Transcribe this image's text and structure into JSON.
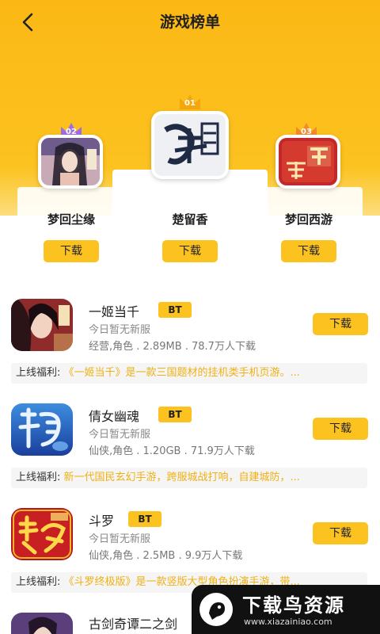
{
  "header": {
    "title": "游戏榜单"
  },
  "ranking": [
    {
      "rank": "02",
      "name": "梦回尘缘",
      "button": "下载"
    },
    {
      "rank": "01",
      "name": "楚留香",
      "button": "下载"
    },
    {
      "rank": "03",
      "name": "梦回西游",
      "button": "下载"
    }
  ],
  "games": [
    {
      "name": "一姬当千",
      "badge": "BT",
      "server": "今日暂无新服",
      "meta": "经营,角色 . 2.89MB . 78.7万人下载",
      "button": "下载",
      "benefit_label": "上线福利:",
      "benefit_text": "《一姬当千》是一款三国题材的挂机类手机页游。..."
    },
    {
      "name": "倩女幽魂",
      "badge": "BT",
      "server": "今日暂无新服",
      "meta": "仙侠,角色 . 1.20GB . 71.9万人下载",
      "button": "下载",
      "benefit_label": "上线福利:",
      "benefit_text": "新一代国民玄幻手游，跨服城战打响，自建城防，..."
    },
    {
      "name": "斗罗",
      "badge": "BT",
      "server": "今日暂无新服",
      "meta": "仙侠,角色 . 2.5MB . 9.9万人下载",
      "button": "下载",
      "benefit_label": "上线福利:",
      "benefit_text": "《斗罗终极版》是一款竖版大型角色扮演手游，带..."
    },
    {
      "name": "古剑奇谭二之剑"
    }
  ],
  "watermark": {
    "brand": "下载鸟资源",
    "url": "www.xiazainiao.com"
  },
  "colors": {
    "accent": "#fcc21f",
    "hero": "#fbb815",
    "benefit_text": "#f0b013"
  }
}
